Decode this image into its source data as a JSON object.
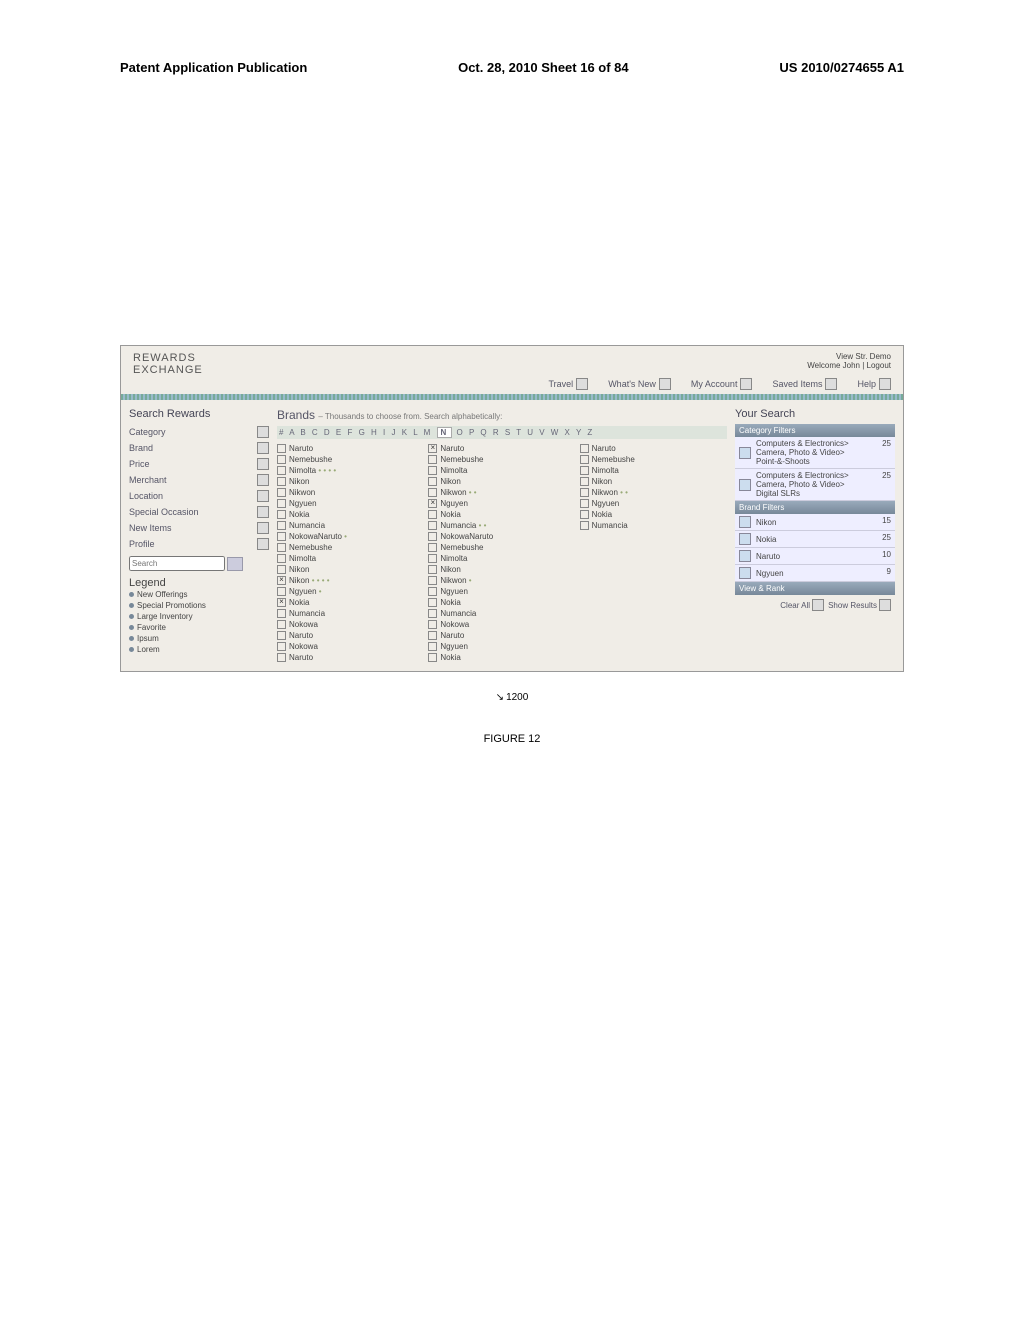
{
  "doc_header": {
    "left": "Patent Application Publication",
    "center": "Oct. 28, 2010  Sheet 16 of 84",
    "right": "US 2010/0274655 A1"
  },
  "topbar": {
    "mode": "View Str. Demo",
    "welcome": "Welcome John",
    "logout": "Logout",
    "logo_line1": "REWARDS",
    "logo_line2": "EXCHANGE"
  },
  "nav": {
    "travel": "Travel",
    "whatsnew": "What's New",
    "myaccount": "My Account",
    "saved": "Saved Items",
    "help": "Help"
  },
  "left_panel": {
    "title": "Search Rewards",
    "items": [
      "Category",
      "Brand",
      "Price",
      "Merchant",
      "Location",
      "Special Occasion",
      "New Items",
      "Profile"
    ],
    "search_label": "Search"
  },
  "legend": {
    "title": "Legend",
    "items": [
      "New Offerings",
      "Special Promotions",
      "Large Inventory",
      "Favorite",
      "Ipsum",
      "Lorem"
    ]
  },
  "center": {
    "title": "Brands",
    "subtitle": "– Thousands to choose from. Search alphabetically:",
    "selected_letter": "N",
    "col1": [
      {
        "n": "Naruto",
        "c": false
      },
      {
        "n": "Nemebushe",
        "c": false
      },
      {
        "n": "Nimolta",
        "c": false,
        "m": "• • • •"
      },
      {
        "n": "Nikon",
        "c": false
      },
      {
        "n": "Nikwon",
        "c": false
      },
      {
        "n": "Ngyuen",
        "c": false
      },
      {
        "n": "Nokia",
        "c": false
      },
      {
        "n": "Numancia",
        "c": false
      },
      {
        "n": "NokowaNaruto",
        "c": false,
        "m": "•"
      },
      {
        "n": "Nemebushe",
        "c": false
      },
      {
        "n": "Nimolta",
        "c": false
      },
      {
        "n": "Nikon",
        "c": false
      },
      {
        "n": "Nikon",
        "c": true,
        "m": "• • • •"
      },
      {
        "n": "Ngyuen",
        "c": false,
        "m": "•"
      },
      {
        "n": "Nokia",
        "c": true
      },
      {
        "n": "Numancia",
        "c": false
      },
      {
        "n": "Nokowa",
        "c": false
      },
      {
        "n": "Naruto",
        "c": false
      },
      {
        "n": "Nokowa",
        "c": false
      },
      {
        "n": "Naruto",
        "c": false
      }
    ],
    "col2": [
      {
        "n": "Naruto",
        "c": true
      },
      {
        "n": "Nemebushe",
        "c": false
      },
      {
        "n": "Nimolta",
        "c": false
      },
      {
        "n": "Nikon",
        "c": false
      },
      {
        "n": "Nikwon",
        "c": false,
        "m": "• •"
      },
      {
        "n": "Nguyen",
        "c": true
      },
      {
        "n": "Nokia",
        "c": false
      },
      {
        "n": "Numancia",
        "c": false,
        "m": "• •"
      },
      {
        "n": "NokowaNaruto",
        "c": false
      },
      {
        "n": "Nemebushe",
        "c": false
      },
      {
        "n": "Nimolta",
        "c": false
      },
      {
        "n": "Nikon",
        "c": false
      },
      {
        "n": "Nikwon",
        "c": false,
        "m": "•"
      },
      {
        "n": "Ngyuen",
        "c": false
      },
      {
        "n": "Nokia",
        "c": false
      },
      {
        "n": "Numancia",
        "c": false
      },
      {
        "n": "Nokowa",
        "c": false
      },
      {
        "n": "Naruto",
        "c": false
      },
      {
        "n": "Ngyuen",
        "c": false
      },
      {
        "n": "Nokia",
        "c": false
      }
    ],
    "col3": [
      {
        "n": "Naruto",
        "c": false
      },
      {
        "n": "Nemebushe",
        "c": false
      },
      {
        "n": "Nimolta",
        "c": false
      },
      {
        "n": "Nikon",
        "c": false
      },
      {
        "n": "Nikwon",
        "c": false,
        "m": "• •"
      },
      {
        "n": "Ngyuen",
        "c": false
      },
      {
        "n": "Nokia",
        "c": false
      },
      {
        "n": "Numancia",
        "c": false
      }
    ]
  },
  "right_panel": {
    "title": "Your Search",
    "category_head": "Category Filters",
    "cat1_line1": "Computers & Electronics>",
    "cat1_line2": "Camera, Photo & Video>",
    "cat1_line3": "Point-&-Shoots",
    "cat1_count": "25",
    "cat2_line1": "Computers & Electronics>",
    "cat2_line2": "Camera, Photo & Video>",
    "cat2_line3": "Digital SLRs",
    "cat2_count": "25",
    "brand_head": "Brand Filters",
    "brands": [
      {
        "name": "Nikon",
        "count": "15"
      },
      {
        "name": "Nokia",
        "count": "25"
      },
      {
        "name": "Naruto",
        "count": "10"
      },
      {
        "name": "Ngyuen",
        "count": "9"
      }
    ],
    "view_head": "View & Rank",
    "clear": "Clear All",
    "show": "Show Results"
  },
  "ref": "1200",
  "figure": "FIGURE 12"
}
